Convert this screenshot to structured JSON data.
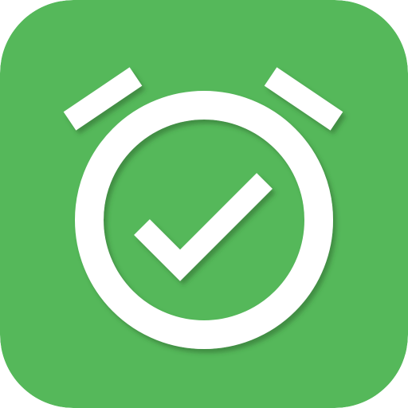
{
  "icon": {
    "name": "alarm-clock-check-icon",
    "background_color": "#55b85a",
    "glyph_color": "#ffffff",
    "shadow_color": "#2f6b33"
  }
}
